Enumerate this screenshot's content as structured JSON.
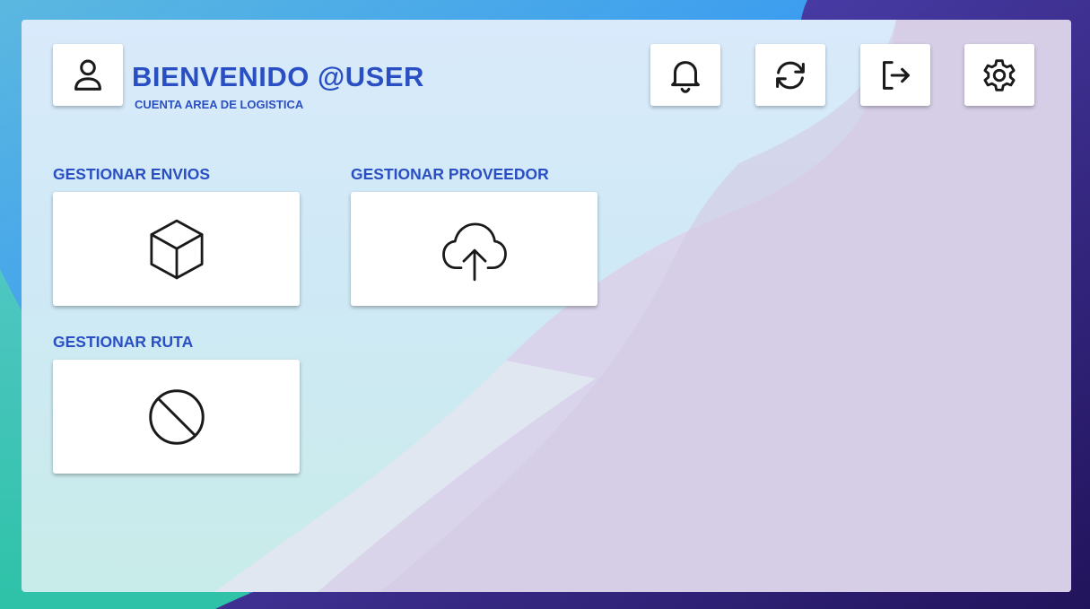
{
  "header": {
    "title": "BIENVENIDO @USER",
    "subtitle": "CUENTA AREA DE LOGISTICA"
  },
  "toolbar": {
    "icons": [
      "user-icon",
      "bell-icon",
      "refresh-icon",
      "logout-icon",
      "gear-icon"
    ]
  },
  "sections": [
    {
      "label": "GESTIONAR ENVIOS",
      "icon": "box-icon"
    },
    {
      "label": "GESTIONAR PROVEEDOR",
      "icon": "cloud-upload-icon"
    },
    {
      "label": "GESTIONAR RUTA",
      "icon": "ban-icon"
    }
  ],
  "colors": {
    "accent": "#2a4fc2",
    "icon_stroke": "#1a1a1a",
    "card": "#ffffff"
  }
}
